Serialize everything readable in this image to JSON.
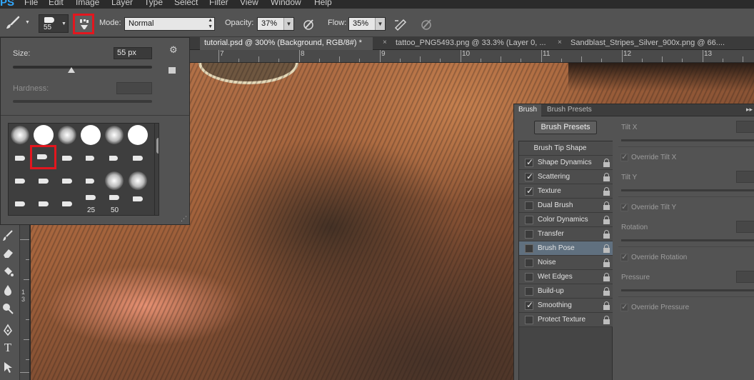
{
  "app": {
    "logo": "PS",
    "menu": [
      "File",
      "Edit",
      "Image",
      "Layer",
      "Type",
      "Select",
      "Filter",
      "View",
      "Window",
      "Help"
    ]
  },
  "options_bar": {
    "brush_size": "55",
    "mode_label": "Mode:",
    "mode_value": "Normal",
    "opacity_label": "Opacity:",
    "opacity_value": "37%",
    "flow_label": "Flow:",
    "flow_value": "35%"
  },
  "tabs": [
    {
      "label": "tutorial.psd @ 300% (Background, RGB/8#) *",
      "active": true
    },
    {
      "label": "tattoo_PNG5493.png @ 33.3% (Layer 0, ...",
      "active": false
    },
    {
      "label": "Sandblast_Stripes_Silver_900x.png @ 66....",
      "active": false
    }
  ],
  "ruler_top": [
    "7",
    "8",
    "9",
    "10",
    "11",
    "12",
    "13"
  ],
  "ruler_left": [
    "1",
    "3"
  ],
  "brush_picker": {
    "size_label": "Size:",
    "size_value": "55 px",
    "size_level": 0.42,
    "hardness_label": "Hardness:",
    "preset_numbers": [
      "25",
      "50"
    ]
  },
  "brush_panel": {
    "tabs": [
      "Brush",
      "Brush Presets"
    ],
    "presets_button": "Brush Presets",
    "heading": "Brush Tip Shape",
    "items": [
      {
        "label": "Shape Dynamics",
        "checked": true,
        "selected": false
      },
      {
        "label": "Scattering",
        "checked": true,
        "selected": false
      },
      {
        "label": "Texture",
        "checked": true,
        "selected": false
      },
      {
        "label": "Dual Brush",
        "checked": false,
        "selected": false
      },
      {
        "label": "Color Dynamics",
        "checked": false,
        "selected": false
      },
      {
        "label": "Transfer",
        "checked": false,
        "selected": false
      },
      {
        "label": "Brush Pose",
        "checked": false,
        "selected": true
      },
      {
        "label": "Noise",
        "checked": false,
        "selected": false
      },
      {
        "label": "Wet Edges",
        "checked": false,
        "selected": false
      },
      {
        "label": "Build-up",
        "checked": false,
        "selected": false
      },
      {
        "label": "Smoothing",
        "checked": true,
        "selected": false
      },
      {
        "label": "Protect Texture",
        "checked": false,
        "selected": false
      }
    ],
    "settings": {
      "tilt_x": "Tilt X",
      "override_tilt_x": "Override Tilt X",
      "tilt_y": "Tilt Y",
      "override_tilt_y": "Override Tilt Y",
      "rotation": "Rotation",
      "override_rotation": "Override Rotation",
      "pressure": "Pressure",
      "override_pressure": "Override Pressure"
    }
  },
  "colors": {
    "highlight": "#e3161e",
    "selected_item": "#60707f",
    "panel_bg": "#535353"
  }
}
